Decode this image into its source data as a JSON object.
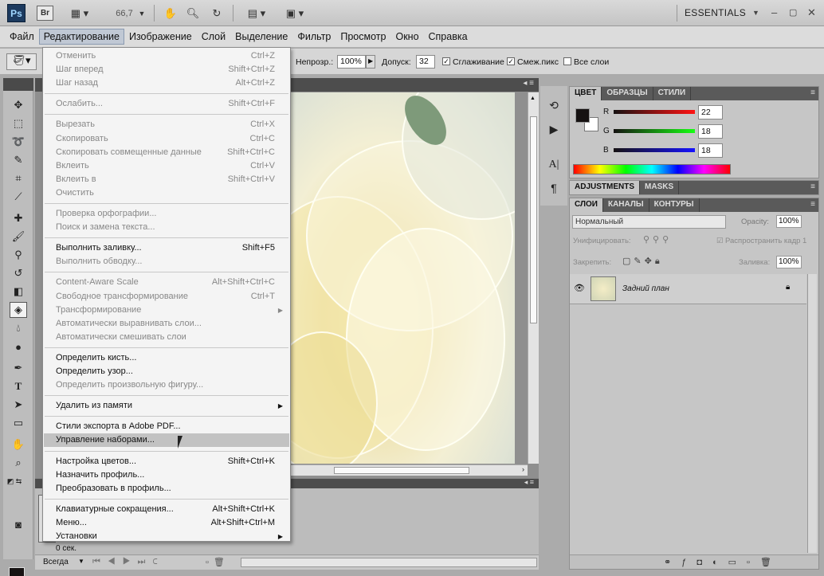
{
  "appbar": {
    "ps_logo": "Ps",
    "br_logo": "Br",
    "zoom": "66,7",
    "workspace": "ESSENTIALS"
  },
  "menubar": [
    "Файл",
    "Редактирование",
    "Изображение",
    "Слой",
    "Выделение",
    "Фильтр",
    "Просмотр",
    "Окно",
    "Справка"
  ],
  "options": {
    "opacity_label": "Непрозр.:",
    "opacity_value": "100%",
    "tolerance_label": "Допуск:",
    "tolerance_value": "32",
    "antialias_label": "Сглаживание",
    "contiguous_label": "Смеж.пикс",
    "all_layers_label": "Все слои"
  },
  "edit_menu": [
    {
      "label": "Отменить",
      "shortcut": "Ctrl+Z",
      "disabled": true
    },
    {
      "label": "Шаг вперед",
      "shortcut": "Shift+Ctrl+Z",
      "disabled": true
    },
    {
      "label": "Шаг назад",
      "shortcut": "Alt+Ctrl+Z",
      "disabled": true
    },
    {
      "sep": true
    },
    {
      "label": "Ослабить...",
      "shortcut": "Shift+Ctrl+F",
      "disabled": true
    },
    {
      "sep": true
    },
    {
      "label": "Вырезать",
      "shortcut": "Ctrl+X",
      "disabled": true
    },
    {
      "label": "Скопировать",
      "shortcut": "Ctrl+C",
      "disabled": true
    },
    {
      "label": "Скопировать совмещенные данные",
      "shortcut": "Shift+Ctrl+C",
      "disabled": true
    },
    {
      "label": "Вклеить",
      "shortcut": "Ctrl+V",
      "disabled": true
    },
    {
      "label": "Вклеить в",
      "shortcut": "Shift+Ctrl+V",
      "disabled": true
    },
    {
      "label": "Очистить",
      "shortcut": "",
      "disabled": true
    },
    {
      "sep": true
    },
    {
      "label": "Проверка орфографии...",
      "shortcut": "",
      "disabled": true
    },
    {
      "label": "Поиск и замена текста...",
      "shortcut": "",
      "disabled": true
    },
    {
      "sep": true
    },
    {
      "label": "Выполнить заливку...",
      "shortcut": "Shift+F5",
      "disabled": false
    },
    {
      "label": "Выполнить обводку...",
      "shortcut": "",
      "disabled": true
    },
    {
      "sep": true
    },
    {
      "label": "Content-Aware Scale",
      "shortcut": "Alt+Shift+Ctrl+C",
      "disabled": true
    },
    {
      "label": "Свободное трансформирование",
      "shortcut": "Ctrl+T",
      "disabled": true
    },
    {
      "label": "Трансформирование",
      "shortcut": "",
      "disabled": true,
      "submenu": true
    },
    {
      "label": "Автоматически выравнивать слои...",
      "shortcut": "",
      "disabled": true
    },
    {
      "label": "Автоматически смешивать слои",
      "shortcut": "",
      "disabled": true
    },
    {
      "sep": true
    },
    {
      "label": "Определить кисть...",
      "shortcut": "",
      "disabled": false
    },
    {
      "label": "Определить узор...",
      "shortcut": "",
      "disabled": false
    },
    {
      "label": "Определить произвольную фигуру...",
      "shortcut": "",
      "disabled": true
    },
    {
      "sep": true
    },
    {
      "label": "Удалить из памяти",
      "shortcut": "",
      "disabled": false,
      "submenu": true
    },
    {
      "sep": true
    },
    {
      "label": "Стили экспорта в Adobe PDF...",
      "shortcut": "",
      "disabled": false
    },
    {
      "label": "Управление наборами...",
      "shortcut": "",
      "disabled": false,
      "highlighted": true
    },
    {
      "sep": true
    },
    {
      "label": "Настройка цветов...",
      "shortcut": "Shift+Ctrl+K",
      "disabled": false
    },
    {
      "label": "Назначить профиль...",
      "shortcut": "",
      "disabled": false
    },
    {
      "label": "Преобразовать в профиль...",
      "shortcut": "",
      "disabled": false
    },
    {
      "sep": true
    },
    {
      "label": "Клавиатурные сокращения...",
      "shortcut": "Alt+Shift+Ctrl+K",
      "disabled": false
    },
    {
      "label": "Меню...",
      "shortcut": "Alt+Shift+Ctrl+M",
      "disabled": false
    },
    {
      "label": "Установки",
      "shortcut": "",
      "disabled": false,
      "submenu": true
    }
  ],
  "color_panel": {
    "tabs": [
      "ЦВЕТ",
      "ОБРАЗЦЫ",
      "СТИЛИ"
    ],
    "channels": [
      {
        "label": "R",
        "value": "22"
      },
      {
        "label": "G",
        "value": "18"
      },
      {
        "label": "B",
        "value": "18"
      }
    ]
  },
  "adjust_panel": {
    "tabs": [
      "ADJUSTMENTS",
      "MASKS"
    ]
  },
  "layers_panel": {
    "tabs": [
      "СЛОИ",
      "КАНАЛЫ",
      "КОНТУРЫ"
    ],
    "blend_mode": "Нормальный",
    "opacity_label": "Opacity:",
    "opacity_value": "100%",
    "unify_label": "Унифицировать:",
    "propagate_label": "Распространить кадр 1",
    "lock_label": "Закрепить:",
    "fill_label": "Заливка:",
    "fill_value": "100%",
    "layer_name": "Задний план"
  },
  "animation": {
    "frame_time": "0 сек.",
    "loop": "Всегда"
  },
  "colors": {
    "menu_bg": "#f4f4f4",
    "highlight": "#c2c2c2",
    "panel_bg": "#c6c6c6"
  }
}
